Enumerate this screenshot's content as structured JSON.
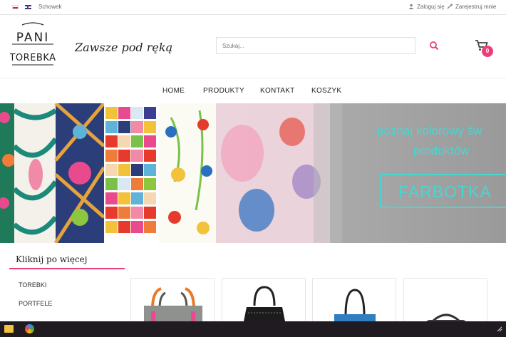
{
  "topbar": {
    "flags": [
      "pl-flag",
      "uk-flag"
    ],
    "clipboard_label": "Schowek",
    "login_label": "Zaloguj się",
    "register_label": "Zarejestruj mnie"
  },
  "header": {
    "logo_line1": "PANI",
    "logo_line2": "TOREBKA",
    "tagline": "Zawsze pod ręką",
    "search_placeholder": "Szukaj...",
    "cart_count": "0"
  },
  "nav": {
    "items": [
      "HOME",
      "PRODUKTY",
      "KONTAKT",
      "KOSZYK"
    ]
  },
  "banner": {
    "line1": "poznaj kolorowy św",
    "line2": "produktów",
    "brand": "FARBOTKA"
  },
  "sidebar": {
    "title": "Kliknij po więcej",
    "items": [
      "TOREBKI",
      "PORTFELE"
    ]
  },
  "products": [
    "grey-bag-with-orange-straps",
    "black-tote-bag",
    "blue-handle-bag",
    "dark-patterned-bag"
  ],
  "colors": {
    "accent": "#ec3e76",
    "banner_text": "#4ad5d0",
    "taskbar": "#201b21"
  }
}
